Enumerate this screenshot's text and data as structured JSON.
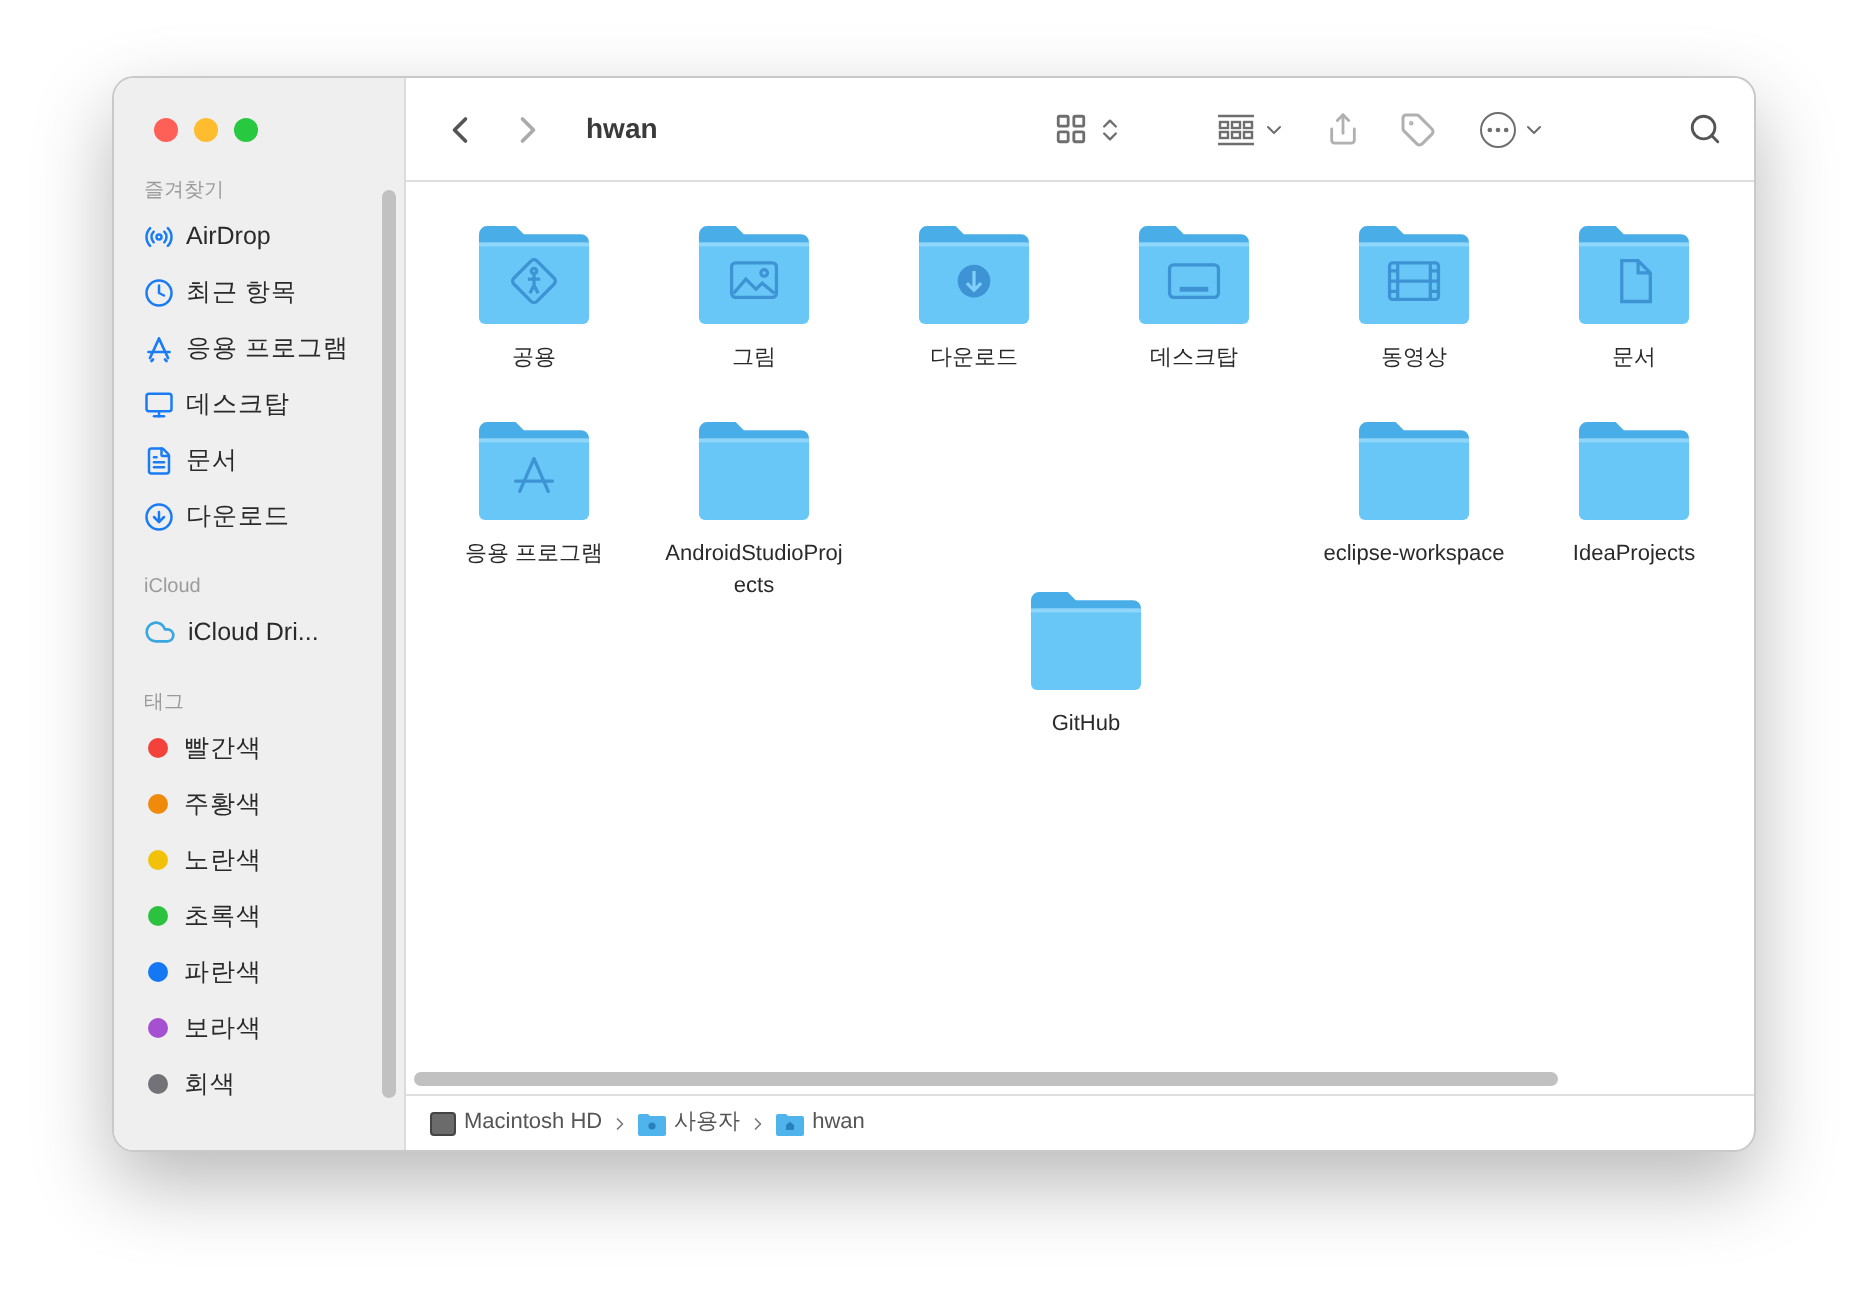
{
  "window": {
    "title": "hwan"
  },
  "sidebar": {
    "sections": [
      {
        "heading": "즐겨찾기",
        "items": [
          {
            "kind": "airdrop",
            "label": "AirDrop"
          },
          {
            "kind": "clock",
            "label": "최근 항목"
          },
          {
            "kind": "apps",
            "label": "응용 프로그램"
          },
          {
            "kind": "desktop",
            "label": "데스크탑"
          },
          {
            "kind": "document",
            "label": "문서"
          },
          {
            "kind": "download",
            "label": "다운로드"
          }
        ]
      },
      {
        "heading": "iCloud",
        "items": [
          {
            "kind": "cloud",
            "label": "iCloud Dri..."
          }
        ]
      },
      {
        "heading": "태그",
        "items": [
          {
            "kind": "tag",
            "label": "빨간색",
            "color": "#f2423b"
          },
          {
            "kind": "tag",
            "label": "주황색",
            "color": "#f08a0b"
          },
          {
            "kind": "tag",
            "label": "노란색",
            "color": "#f2c10a"
          },
          {
            "kind": "tag",
            "label": "초록색",
            "color": "#2cc13f"
          },
          {
            "kind": "tag",
            "label": "파란색",
            "color": "#1478f5"
          },
          {
            "kind": "tag",
            "label": "보라색",
            "color": "#a54fd1"
          },
          {
            "kind": "tag",
            "label": "회색",
            "color": "#737377"
          }
        ]
      }
    ]
  },
  "folders": [
    {
      "kind": "public",
      "label": "공용"
    },
    {
      "kind": "pictures",
      "label": "그림"
    },
    {
      "kind": "download",
      "label": "다운로드"
    },
    {
      "kind": "desktop",
      "label": "데스크탑"
    },
    {
      "kind": "movies",
      "label": "동영상"
    },
    {
      "kind": "document",
      "label": "문서"
    },
    {
      "kind": "apps",
      "label": "응용 프로그램"
    },
    {
      "kind": "plain",
      "label": "AndroidStudioProjects"
    },
    {
      "kind": "plain",
      "label": "eclipse-workspace"
    },
    {
      "kind": "plain",
      "label": "IdeaProjects"
    },
    {
      "kind": "plain",
      "label": "GitHub"
    }
  ],
  "path_bar": [
    {
      "kind": "disk",
      "label": "Macintosh HD"
    },
    {
      "kind": "folder",
      "label": "사용자"
    },
    {
      "kind": "home",
      "label": "hwan"
    }
  ]
}
